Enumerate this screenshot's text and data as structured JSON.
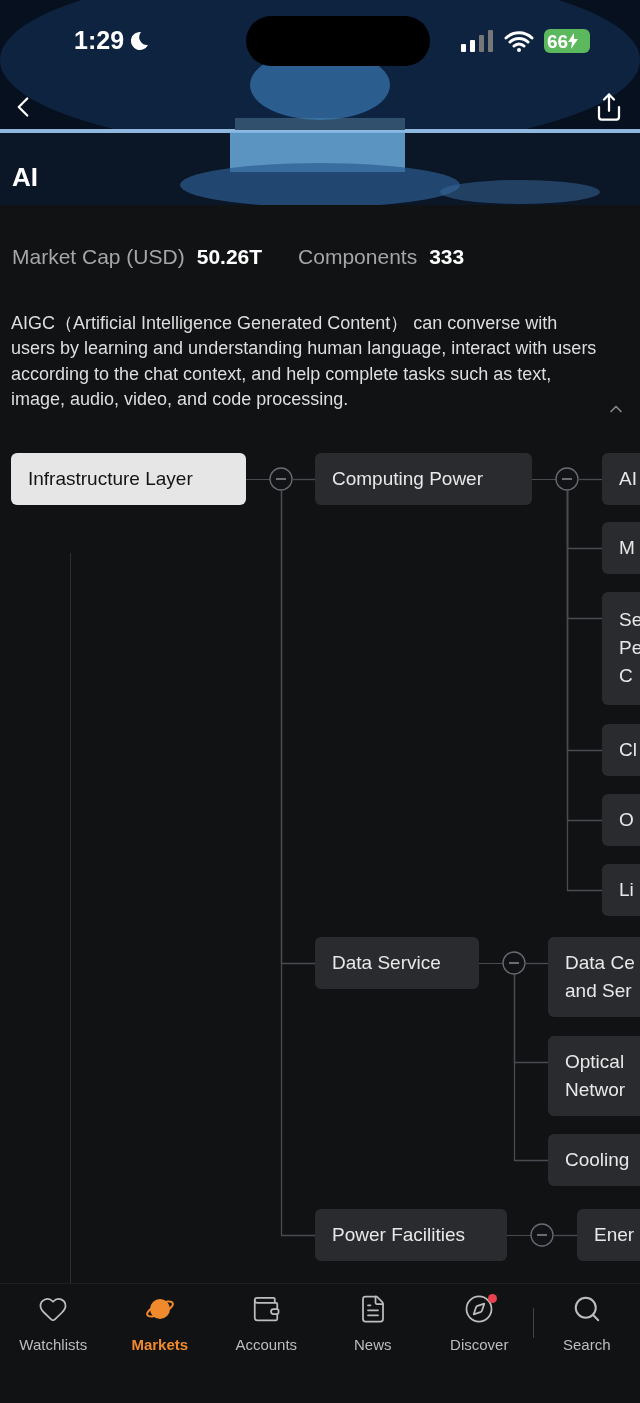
{
  "status_bar": {
    "time": "1:29",
    "battery": "66"
  },
  "header": {
    "title": "AI"
  },
  "stats": [
    {
      "label": "Market Cap (USD)",
      "value": "50.26T"
    },
    {
      "label": "Components",
      "value": "333"
    }
  ],
  "description": {
    "text": "AIGC（Artificial Intelligence Generated Content） can converse with users by learning and understanding human language, interact with users according to the chat context, and help complete tasks such as text, image, audio, video, and code processing.",
    "expanded": true
  },
  "mind_map": {
    "label": "Infrastructure Layer",
    "selected": true,
    "expanded": true,
    "children": [
      {
        "label": "Computing Power",
        "selected": false,
        "expanded": true,
        "children": [
          {
            "label": "AI",
            "selected": false
          },
          {
            "label": "M",
            "selected": false
          },
          {
            "label": "Se\nPe\nC",
            "selected": false
          },
          {
            "label": "Cl",
            "selected": false
          },
          {
            "label": "O",
            "selected": false
          },
          {
            "label": "Li",
            "selected": false
          }
        ]
      },
      {
        "label": "Data Service",
        "selected": false,
        "expanded": true,
        "children": [
          {
            "label": "Data Ce\nand Ser",
            "selected": false
          },
          {
            "label": "Optical\nNetwor",
            "selected": false
          },
          {
            "label": "Cooling",
            "selected": false
          }
        ]
      },
      {
        "label": "Power Facilities",
        "selected": false,
        "expanded": true,
        "children": [
          {
            "label": "Ener",
            "selected": false
          }
        ]
      }
    ]
  },
  "tab_bar": [
    {
      "label": "Watchlists",
      "selected": false,
      "dot": false
    },
    {
      "label": "Markets",
      "selected": true,
      "dot": false
    },
    {
      "label": "Accounts",
      "selected": false,
      "dot": false
    },
    {
      "label": "News",
      "selected": false,
      "dot": false
    },
    {
      "label": "Discover",
      "selected": false,
      "dot": true
    },
    {
      "label": "Search",
      "selected": false,
      "dot": false
    }
  ]
}
